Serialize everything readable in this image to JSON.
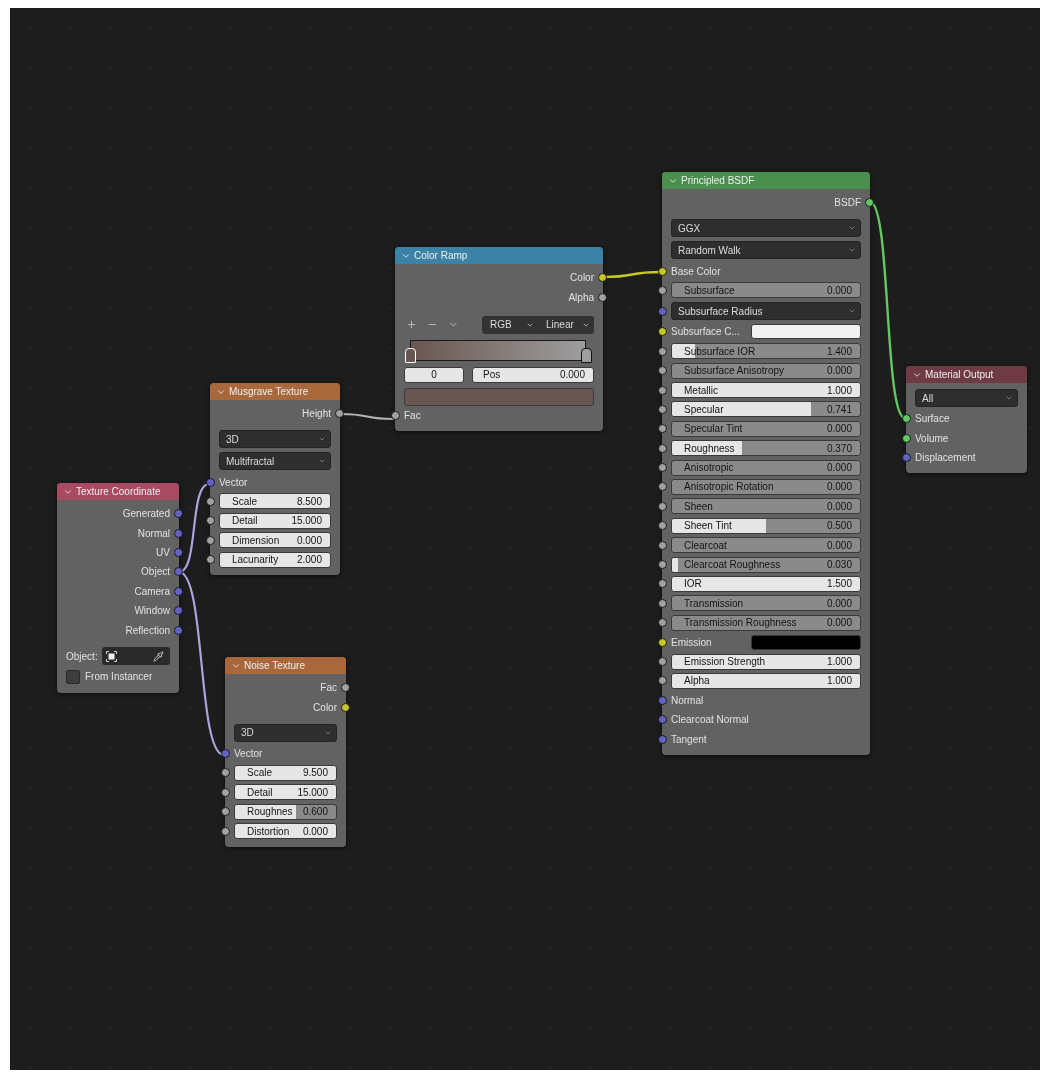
{
  "nodes": [
    {
      "title": "Texture Coordinate",
      "color": "#a84a62",
      "rows": [
        {
          "kind": "output",
          "label": "Generated",
          "color": "#6363c7"
        },
        {
          "kind": "output",
          "label": "Normal",
          "color": "#6363c7"
        },
        {
          "kind": "output",
          "label": "UV",
          "color": "#6363c7"
        },
        {
          "kind": "output",
          "label": "Object",
          "color": "#6363c7"
        },
        {
          "kind": "output",
          "label": "Camera",
          "color": "#6363c7"
        },
        {
          "kind": "output",
          "label": "Window",
          "color": "#6363c7"
        },
        {
          "kind": "output",
          "label": "Reflection",
          "color": "#6363c7"
        },
        {
          "kind": "object",
          "label": "Object:"
        },
        {
          "kind": "checkbox",
          "label": "From Instancer",
          "checked": false
        }
      ]
    },
    {
      "title": "Musgrave Texture",
      "color": "#a8683c",
      "rows": [
        {
          "kind": "output",
          "label": "Height",
          "color": "#a1a1a1"
        },
        {
          "kind": "dropdown",
          "value": "3D"
        },
        {
          "kind": "dropdown",
          "value": "Multifractal"
        },
        {
          "kind": "input",
          "label": "Vector",
          "color": "#6363c7"
        },
        {
          "kind": "number",
          "label": "Scale",
          "value": "8.500",
          "color": "#a1a1a1"
        },
        {
          "kind": "number",
          "label": "Detail",
          "value": "15.000",
          "color": "#a1a1a1"
        },
        {
          "kind": "number",
          "label": "Dimension",
          "value": "0.000",
          "color": "#a1a1a1"
        },
        {
          "kind": "number",
          "label": "Lacunarity",
          "value": "2.000",
          "color": "#a1a1a1"
        }
      ]
    },
    {
      "title": "Noise Texture",
      "color": "#a8683c",
      "rows": [
        {
          "kind": "output",
          "label": "Fac",
          "color": "#a1a1a1"
        },
        {
          "kind": "output",
          "label": "Color",
          "color": "#c7c729"
        },
        {
          "kind": "dropdown",
          "value": "3D"
        },
        {
          "kind": "input",
          "label": "Vector",
          "color": "#6363c7"
        },
        {
          "kind": "number",
          "label": "Scale",
          "value": "9.500",
          "color": "#a1a1a1"
        },
        {
          "kind": "number",
          "label": "Detail",
          "value": "15.000",
          "color": "#a1a1a1"
        },
        {
          "kind": "slider",
          "label": "Roughnes",
          "value": "0.600",
          "level": 0.6,
          "color": "#a1a1a1"
        },
        {
          "kind": "number",
          "label": "Distortion",
          "value": "0.000",
          "color": "#a1a1a1"
        }
      ]
    },
    {
      "title": "Color Ramp",
      "color": "#3b82a6",
      "rows": [
        {
          "kind": "output",
          "label": "Color",
          "color": "#c7c729"
        },
        {
          "kind": "output",
          "label": "Alpha",
          "color": "#a1a1a1"
        },
        {
          "kind": "ramp",
          "color_mode": "RGB",
          "interpolation": "Linear",
          "index": "0",
          "pos_label": "Pos",
          "pos_value": "0.000",
          "stops": [
            {
              "color": "#6a5650",
              "selected": true
            },
            {
              "color": "#9e9e9e",
              "selected": false
            }
          ]
        },
        {
          "kind": "input",
          "label": "Fac",
          "color": "#a1a1a1"
        }
      ]
    },
    {
      "title": "Principled BSDF",
      "color": "#4a8f4e",
      "rows": [
        {
          "kind": "output",
          "label": "BSDF",
          "color": "#63c763"
        },
        {
          "kind": "dropdown",
          "value": "GGX"
        },
        {
          "kind": "dropdown",
          "value": "Random Walk"
        },
        {
          "kind": "input",
          "label": "Base Color",
          "color": "#c7c729"
        },
        {
          "kind": "slider",
          "label": "Subsurface",
          "value": "0.000",
          "level": 0,
          "color": "#a1a1a1"
        },
        {
          "kind": "dropdown",
          "value": "Subsurface Radius",
          "color": "#6363c7"
        },
        {
          "kind": "swatch",
          "label": "Subsurface C...",
          "swatch": {
            "color": "#f0f0f0"
          },
          "color": "#c7c729"
        },
        {
          "kind": "slider",
          "label": "Subsurface IOR",
          "value": "1.400",
          "level": 0.12,
          "color": "#a1a1a1"
        },
        {
          "kind": "slider",
          "label": "Subsurface Anisotropy",
          "value": "0.000",
          "level": 0,
          "color": "#a1a1a1"
        },
        {
          "kind": "slider",
          "label": "Metallic",
          "value": "1.000",
          "level": 1,
          "color": "#a1a1a1"
        },
        {
          "kind": "slider",
          "label": "Specular",
          "value": "0.741",
          "level": 0.741,
          "color": "#a1a1a1"
        },
        {
          "kind": "slider",
          "label": "Specular Tint",
          "value": "0.000",
          "level": 0,
          "color": "#a1a1a1"
        },
        {
          "kind": "slider",
          "label": "Roughness",
          "value": "0.370",
          "level": 0.37,
          "color": "#a1a1a1"
        },
        {
          "kind": "slider",
          "label": "Anisotropic",
          "value": "0.000",
          "level": 0,
          "color": "#a1a1a1"
        },
        {
          "kind": "slider",
          "label": "Anisotropic Rotation",
          "value": "0.000",
          "level": 0,
          "color": "#a1a1a1"
        },
        {
          "kind": "slider",
          "label": "Sheen",
          "value": "0.000",
          "level": 0,
          "color": "#a1a1a1"
        },
        {
          "kind": "slider",
          "label": "Sheen Tint",
          "value": "0.500",
          "level": 0.5,
          "color": "#a1a1a1"
        },
        {
          "kind": "slider",
          "label": "Clearcoat",
          "value": "0.000",
          "level": 0,
          "color": "#a1a1a1"
        },
        {
          "kind": "slider",
          "label": "Clearcoat Roughness",
          "value": "0.030",
          "level": 0.03,
          "color": "#a1a1a1"
        },
        {
          "kind": "number",
          "label": "IOR",
          "value": "1.500",
          "color": "#a1a1a1"
        },
        {
          "kind": "slider",
          "label": "Transmission",
          "value": "0.000",
          "level": 0,
          "color": "#a1a1a1"
        },
        {
          "kind": "slider",
          "label": "Transmission Roughness",
          "value": "0.000",
          "level": 0,
          "color": "#a1a1a1"
        },
        {
          "kind": "swatch",
          "label": "Emission",
          "swatch": {
            "color": "#000000"
          },
          "color": "#c7c729"
        },
        {
          "kind": "number",
          "label": "Emission Strength",
          "value": "1.000",
          "color": "#a1a1a1"
        },
        {
          "kind": "slider",
          "label": "Alpha",
          "value": "1.000",
          "level": 1,
          "color": "#a1a1a1"
        },
        {
          "kind": "input",
          "label": "Normal",
          "color": "#6363c7"
        },
        {
          "kind": "input",
          "label": "Clearcoat Normal",
          "color": "#6363c7"
        },
        {
          "kind": "input",
          "label": "Tangent",
          "color": "#6363c7"
        }
      ]
    },
    {
      "title": "Material Output",
      "color": "#6e3a44",
      "rows": [
        {
          "kind": "dropdown",
          "value": "All"
        },
        {
          "kind": "input",
          "label": "Surface",
          "color": "#63c763"
        },
        {
          "kind": "input",
          "label": "Volume",
          "color": "#63c763"
        },
        {
          "kind": "input",
          "label": "Displacement",
          "color": "#6363c7"
        }
      ]
    }
  ]
}
